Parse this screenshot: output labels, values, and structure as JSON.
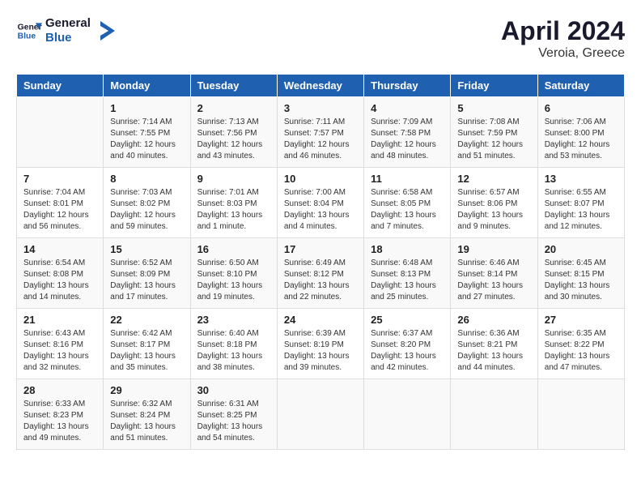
{
  "header": {
    "logo_line1": "General",
    "logo_line2": "Blue",
    "title": "April 2024",
    "subtitle": "Veroia, Greece"
  },
  "days_of_week": [
    "Sunday",
    "Monday",
    "Tuesday",
    "Wednesday",
    "Thursday",
    "Friday",
    "Saturday"
  ],
  "weeks": [
    [
      {
        "day": "",
        "info": ""
      },
      {
        "day": "1",
        "info": "Sunrise: 7:14 AM\nSunset: 7:55 PM\nDaylight: 12 hours\nand 40 minutes."
      },
      {
        "day": "2",
        "info": "Sunrise: 7:13 AM\nSunset: 7:56 PM\nDaylight: 12 hours\nand 43 minutes."
      },
      {
        "day": "3",
        "info": "Sunrise: 7:11 AM\nSunset: 7:57 PM\nDaylight: 12 hours\nand 46 minutes."
      },
      {
        "day": "4",
        "info": "Sunrise: 7:09 AM\nSunset: 7:58 PM\nDaylight: 12 hours\nand 48 minutes."
      },
      {
        "day": "5",
        "info": "Sunrise: 7:08 AM\nSunset: 7:59 PM\nDaylight: 12 hours\nand 51 minutes."
      },
      {
        "day": "6",
        "info": "Sunrise: 7:06 AM\nSunset: 8:00 PM\nDaylight: 12 hours\nand 53 minutes."
      }
    ],
    [
      {
        "day": "7",
        "info": "Sunrise: 7:04 AM\nSunset: 8:01 PM\nDaylight: 12 hours\nand 56 minutes."
      },
      {
        "day": "8",
        "info": "Sunrise: 7:03 AM\nSunset: 8:02 PM\nDaylight: 12 hours\nand 59 minutes."
      },
      {
        "day": "9",
        "info": "Sunrise: 7:01 AM\nSunset: 8:03 PM\nDaylight: 13 hours\nand 1 minute."
      },
      {
        "day": "10",
        "info": "Sunrise: 7:00 AM\nSunset: 8:04 PM\nDaylight: 13 hours\nand 4 minutes."
      },
      {
        "day": "11",
        "info": "Sunrise: 6:58 AM\nSunset: 8:05 PM\nDaylight: 13 hours\nand 7 minutes."
      },
      {
        "day": "12",
        "info": "Sunrise: 6:57 AM\nSunset: 8:06 PM\nDaylight: 13 hours\nand 9 minutes."
      },
      {
        "day": "13",
        "info": "Sunrise: 6:55 AM\nSunset: 8:07 PM\nDaylight: 13 hours\nand 12 minutes."
      }
    ],
    [
      {
        "day": "14",
        "info": "Sunrise: 6:54 AM\nSunset: 8:08 PM\nDaylight: 13 hours\nand 14 minutes."
      },
      {
        "day": "15",
        "info": "Sunrise: 6:52 AM\nSunset: 8:09 PM\nDaylight: 13 hours\nand 17 minutes."
      },
      {
        "day": "16",
        "info": "Sunrise: 6:50 AM\nSunset: 8:10 PM\nDaylight: 13 hours\nand 19 minutes."
      },
      {
        "day": "17",
        "info": "Sunrise: 6:49 AM\nSunset: 8:12 PM\nDaylight: 13 hours\nand 22 minutes."
      },
      {
        "day": "18",
        "info": "Sunrise: 6:48 AM\nSunset: 8:13 PM\nDaylight: 13 hours\nand 25 minutes."
      },
      {
        "day": "19",
        "info": "Sunrise: 6:46 AM\nSunset: 8:14 PM\nDaylight: 13 hours\nand 27 minutes."
      },
      {
        "day": "20",
        "info": "Sunrise: 6:45 AM\nSunset: 8:15 PM\nDaylight: 13 hours\nand 30 minutes."
      }
    ],
    [
      {
        "day": "21",
        "info": "Sunrise: 6:43 AM\nSunset: 8:16 PM\nDaylight: 13 hours\nand 32 minutes."
      },
      {
        "day": "22",
        "info": "Sunrise: 6:42 AM\nSunset: 8:17 PM\nDaylight: 13 hours\nand 35 minutes."
      },
      {
        "day": "23",
        "info": "Sunrise: 6:40 AM\nSunset: 8:18 PM\nDaylight: 13 hours\nand 38 minutes."
      },
      {
        "day": "24",
        "info": "Sunrise: 6:39 AM\nSunset: 8:19 PM\nDaylight: 13 hours\nand 39 minutes."
      },
      {
        "day": "25",
        "info": "Sunrise: 6:37 AM\nSunset: 8:20 PM\nDaylight: 13 hours\nand 42 minutes."
      },
      {
        "day": "26",
        "info": "Sunrise: 6:36 AM\nSunset: 8:21 PM\nDaylight: 13 hours\nand 44 minutes."
      },
      {
        "day": "27",
        "info": "Sunrise: 6:35 AM\nSunset: 8:22 PM\nDaylight: 13 hours\nand 47 minutes."
      }
    ],
    [
      {
        "day": "28",
        "info": "Sunrise: 6:33 AM\nSunset: 8:23 PM\nDaylight: 13 hours\nand 49 minutes."
      },
      {
        "day": "29",
        "info": "Sunrise: 6:32 AM\nSunset: 8:24 PM\nDaylight: 13 hours\nand 51 minutes."
      },
      {
        "day": "30",
        "info": "Sunrise: 6:31 AM\nSunset: 8:25 PM\nDaylight: 13 hours\nand 54 minutes."
      },
      {
        "day": "",
        "info": ""
      },
      {
        "day": "",
        "info": ""
      },
      {
        "day": "",
        "info": ""
      },
      {
        "day": "",
        "info": ""
      }
    ]
  ]
}
